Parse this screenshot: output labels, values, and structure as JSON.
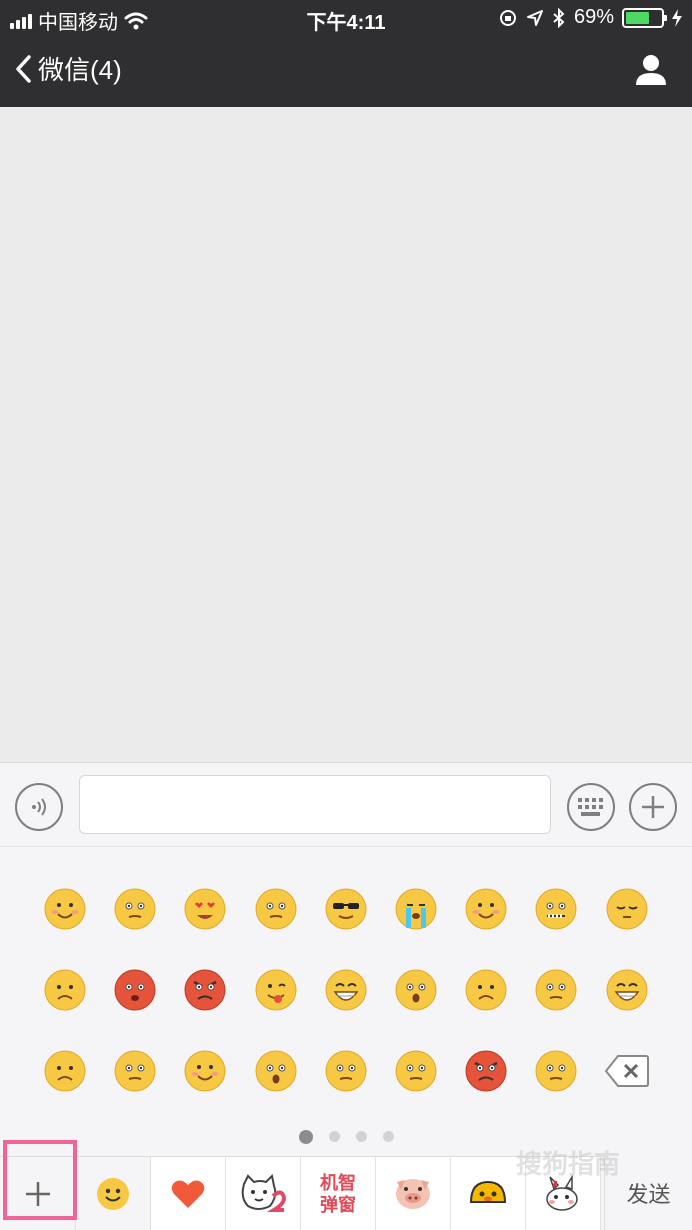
{
  "status_bar": {
    "carrier": "中国移动",
    "time": "下午4:11",
    "battery_percent": "69%",
    "battery_level": 0.69
  },
  "nav": {
    "back_label": "微信(4)"
  },
  "input_bar": {
    "message_value": ""
  },
  "emoji_panel": {
    "rows": [
      [
        "smile",
        "awkward",
        "heart-eyes",
        "angry-stare",
        "cool",
        "crying",
        "shy-blush",
        "zip-mouth",
        "sleepy"
      ],
      [
        "tears",
        "scared-blush",
        "furious",
        "tongue-out",
        "grin",
        "surprised",
        "sad",
        "pleading",
        "laugh-cry"
      ],
      [
        "nauseous",
        "yawn",
        "happy-blush",
        "shocked",
        "confused",
        "eye-roll",
        "rage",
        "sweat"
      ]
    ],
    "page_count": 4,
    "active_page": 1
  },
  "tab_bar": {
    "smart_label_line1": "机智",
    "smart_label_line2": "弹窗",
    "send_label": "发送"
  },
  "watermark": "搜狗指南",
  "colors": {
    "header_bg": "#2f2f31",
    "battery_green": "#4cd964",
    "highlight_pink": "#f06595",
    "emoji_yellow": "#f7c844"
  }
}
